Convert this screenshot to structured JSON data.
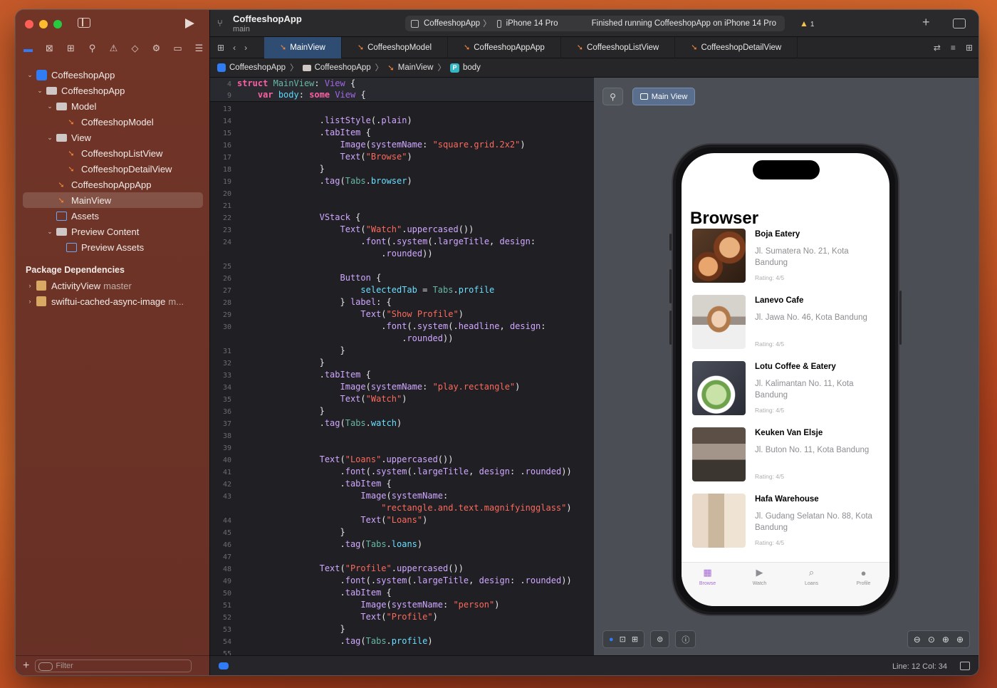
{
  "toolbar": {
    "project_name": "CoffeeshopApp",
    "branch": "main",
    "scheme": "CoffeeshopApp",
    "device": "iPhone 14 Pro",
    "status": "Finished running CoffeeshopApp on iPhone 14 Pro",
    "warning_count": "1"
  },
  "tabs": [
    {
      "label": "MainView",
      "active": true
    },
    {
      "label": "CoffeeshopModel"
    },
    {
      "label": "CoffeeshopAppApp"
    },
    {
      "label": "CoffeeshopListView"
    },
    {
      "label": "CoffeeshopDetailView"
    }
  ],
  "breadcrumb": [
    "CoffeeshopApp",
    "CoffeeshopApp",
    "MainView",
    "body"
  ],
  "navigator": {
    "items": [
      {
        "label": "CoffeeshopApp",
        "kind": "project",
        "indent": 0,
        "chev": "v"
      },
      {
        "label": "CoffeeshopApp",
        "kind": "folder",
        "indent": 1,
        "chev": "v"
      },
      {
        "label": "Model",
        "kind": "folder",
        "indent": 2,
        "chev": "v"
      },
      {
        "label": "CoffeeshopModel",
        "kind": "swift",
        "indent": 3,
        "chev": ""
      },
      {
        "label": "View",
        "kind": "folder",
        "indent": 2,
        "chev": "v"
      },
      {
        "label": "CoffeeshopListView",
        "kind": "swift",
        "indent": 3,
        "chev": ""
      },
      {
        "label": "CoffeeshopDetailView",
        "kind": "swift",
        "indent": 3,
        "chev": ""
      },
      {
        "label": "CoffeeshopAppApp",
        "kind": "swift",
        "indent": 2,
        "chev": ""
      },
      {
        "label": "MainView",
        "kind": "swift",
        "indent": 2,
        "chev": "",
        "selected": true
      },
      {
        "label": "Assets",
        "kind": "assets",
        "indent": 2,
        "chev": ""
      },
      {
        "label": "Preview Content",
        "kind": "folder",
        "indent": 2,
        "chev": "v"
      },
      {
        "label": "Preview Assets",
        "kind": "assets",
        "indent": 3,
        "chev": ""
      }
    ],
    "packages_title": "Package Dependencies",
    "packages": [
      {
        "name": "ActivityView",
        "detail": "master"
      },
      {
        "name": "swiftui-cached-async-image",
        "detail": "m..."
      }
    ],
    "filter_placeholder": "Filter"
  },
  "code": {
    "sticky": [
      {
        "n": "4",
        "html": "<span class='kw'>struct</span> <span class='cy'>MainView</span>: <span class='fn'>View</span> {"
      },
      {
        "n": "9",
        "html": "    <span class='kw'>var</span> <span class='ty'>body</span>: <span class='kw'>some</span> <span class='fn'>View</span> {"
      }
    ],
    "lines": [
      {
        "n": "13",
        "html": ""
      },
      {
        "n": "14",
        "html": "                .<span class='pr'>listStyle</span>(.<span class='pr'>plain</span>)"
      },
      {
        "n": "15",
        "html": "                .<span class='pr'>tabItem</span> {"
      },
      {
        "n": "16",
        "html": "                    <span class='pr'>Image</span>(<span class='pr'>systemName</span>: <span class='st'>\"square.grid.2x2\"</span>)"
      },
      {
        "n": "17",
        "html": "                    <span class='pr'>Text</span>(<span class='st'>\"Browse\"</span>)"
      },
      {
        "n": "18",
        "html": "                }"
      },
      {
        "n": "19",
        "html": "                .<span class='pr'>tag</span>(<span class='cy'>Tabs</span>.<span class='ok'>browser</span>)"
      },
      {
        "n": "20",
        "html": ""
      },
      {
        "n": "21",
        "html": ""
      },
      {
        "n": "22",
        "html": "                <span class='pr'>VStack</span> {"
      },
      {
        "n": "23",
        "html": "                    <span class='pr'>Text</span>(<span class='st'>\"Watch\"</span>.<span class='pr'>uppercased</span>())"
      },
      {
        "n": "24",
        "html": "                        .<span class='pr'>font</span>(.<span class='pr'>system</span>(.<span class='pr'>largeTitle</span>, <span class='pr'>design</span>:"
      },
      {
        "n": "",
        "html": "                            .<span class='pr'>rounded</span>))"
      },
      {
        "n": "25",
        "html": ""
      },
      {
        "n": "26",
        "html": "                    <span class='pr'>Button</span> {"
      },
      {
        "n": "27",
        "html": "                        <span class='ok'>selectedTab</span> = <span class='cy'>Tabs</span>.<span class='ok'>profile</span>"
      },
      {
        "n": "28",
        "html": "                    } <span class='pr'>label</span>: {"
      },
      {
        "n": "29",
        "html": "                        <span class='pr'>Text</span>(<span class='st'>\"Show Profile\"</span>)"
      },
      {
        "n": "30",
        "html": "                            .<span class='pr'>font</span>(.<span class='pr'>system</span>(.<span class='pr'>headline</span>, <span class='pr'>design</span>:"
      },
      {
        "n": "",
        "html": "                                .<span class='pr'>rounded</span>))"
      },
      {
        "n": "31",
        "html": "                    }"
      },
      {
        "n": "32",
        "html": "                }"
      },
      {
        "n": "33",
        "html": "                .<span class='pr'>tabItem</span> {"
      },
      {
        "n": "34",
        "html": "                    <span class='pr'>Image</span>(<span class='pr'>systemName</span>: <span class='st'>\"play.rectangle\"</span>)"
      },
      {
        "n": "35",
        "html": "                    <span class='pr'>Text</span>(<span class='st'>\"Watch\"</span>)"
      },
      {
        "n": "36",
        "html": "                }"
      },
      {
        "n": "37",
        "html": "                .<span class='pr'>tag</span>(<span class='cy'>Tabs</span>.<span class='ok'>watch</span>)"
      },
      {
        "n": "38",
        "html": ""
      },
      {
        "n": "39",
        "html": ""
      },
      {
        "n": "40",
        "html": "                <span class='pr'>Text</span>(<span class='st'>\"Loans\"</span>.<span class='pr'>uppercased</span>())"
      },
      {
        "n": "41",
        "html": "                    .<span class='pr'>font</span>(.<span class='pr'>system</span>(.<span class='pr'>largeTitle</span>, <span class='pr'>design</span>: .<span class='pr'>rounded</span>))"
      },
      {
        "n": "42",
        "html": "                    .<span class='pr'>tabItem</span> {"
      },
      {
        "n": "43",
        "html": "                        <span class='pr'>Image</span>(<span class='pr'>systemName</span>:"
      },
      {
        "n": "",
        "html": "                            <span class='st'>\"rectangle.and.text.magnifyingglass\"</span>)"
      },
      {
        "n": "44",
        "html": "                        <span class='pr'>Text</span>(<span class='st'>\"Loans\"</span>)"
      },
      {
        "n": "45",
        "html": "                    }"
      },
      {
        "n": "46",
        "html": "                    .<span class='pr'>tag</span>(<span class='cy'>Tabs</span>.<span class='ok'>loans</span>)"
      },
      {
        "n": "47",
        "html": ""
      },
      {
        "n": "48",
        "html": "                <span class='pr'>Text</span>(<span class='st'>\"Profile\"</span>.<span class='pr'>uppercased</span>())"
      },
      {
        "n": "49",
        "html": "                    .<span class='pr'>font</span>(.<span class='pr'>system</span>(.<span class='pr'>largeTitle</span>, <span class='pr'>design</span>: .<span class='pr'>rounded</span>))"
      },
      {
        "n": "50",
        "html": "                    .<span class='pr'>tabItem</span> {"
      },
      {
        "n": "51",
        "html": "                        <span class='pr'>Image</span>(<span class='pr'>systemName</span>: <span class='st'>\"person\"</span>)"
      },
      {
        "n": "52",
        "html": "                        <span class='pr'>Text</span>(<span class='st'>\"Profile\"</span>)"
      },
      {
        "n": "53",
        "html": "                    }"
      },
      {
        "n": "54",
        "html": "                    .<span class='pr'>tag</span>(<span class='cy'>Tabs</span>.<span class='ok'>profile</span>)"
      },
      {
        "n": "55",
        "html": ""
      }
    ]
  },
  "preview": {
    "mode_label": "Main View",
    "title": "Browser",
    "items": [
      {
        "name": "Boja Eatery",
        "address": "Jl. Sumatera No. 21, Kota Bandung",
        "rating": "Rating: 4/5",
        "thumb": "latte"
      },
      {
        "name": "Lanevo Cafe",
        "address": "Jl. Jawa No. 46, Kota Bandung",
        "rating": "Rating: 4/5",
        "thumb": "barista"
      },
      {
        "name": "Lotu Coffee & Eatery",
        "address": "Jl. Kalimantan No. 11, Kota Bandung",
        "rating": "Rating: 4/5",
        "thumb": "matcha"
      },
      {
        "name": "Keuken Van Elsje",
        "address": "Jl. Buton No. 11, Kota Bandung",
        "rating": "Rating: 4/5",
        "thumb": "counter"
      },
      {
        "name": "Hafa Warehouse",
        "address": "Jl. Gudang Selatan No. 88, Kota Bandung",
        "rating": "Rating: 4/5",
        "thumb": "warehouse"
      }
    ],
    "tabs": [
      {
        "label": "Browse",
        "icon": "square-grid-icon",
        "active": true
      },
      {
        "label": "Watch",
        "icon": "play-rectangle-icon"
      },
      {
        "label": "Loans",
        "icon": "magnifying-glass-icon"
      },
      {
        "label": "Profile",
        "icon": "person-icon"
      }
    ]
  },
  "statusbar": {
    "line_col": "Line: 12  Col: 34"
  },
  "colors": {
    "accent": "#2f7cf6",
    "swift": "#f6863d",
    "tab_active": "#a66bd6"
  }
}
